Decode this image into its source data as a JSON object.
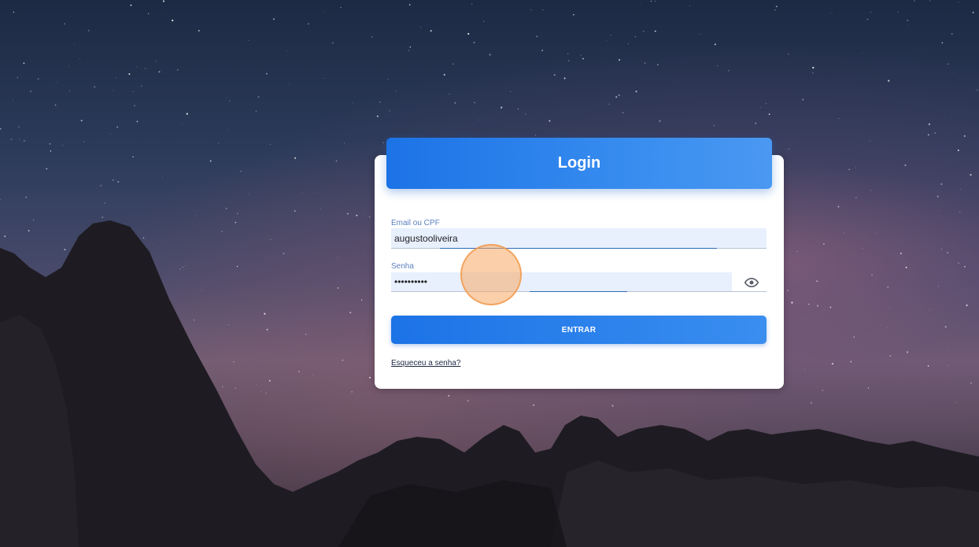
{
  "login": {
    "title": "Login",
    "email_label": "Email ou CPF",
    "email_value": "augustooliveira",
    "password_label": "Senha",
    "password_value": "••••••••••",
    "submit_label": "ENTRAR",
    "forgot_link": "Esqueceu a senha?"
  },
  "icons": {
    "password_toggle": "eye-icon"
  },
  "colors": {
    "primary": "#1c73e6",
    "primary_light": "#4a98f1",
    "input_bg": "#e8f0fe",
    "label": "#5b7fbf",
    "click_indicator": "#f5a864"
  }
}
